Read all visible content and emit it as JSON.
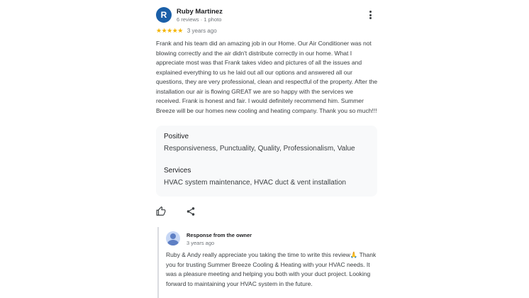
{
  "review": {
    "avatar_letter": "R",
    "name": "Ruby Martinez",
    "meta": "6 reviews · 1 photo",
    "stars": "★★★★★",
    "rating": 5,
    "date": "3 years ago",
    "text": "Frank and his team did an amazing job in our Home. Our Air Conditioner was not blowing correctly and the air didn't distribute correctly in our home. What I appreciate most was that Frank takes video and pictures of all the issues and explained everything to us he laid out all our options and answered all our questions, they are very professional, clean and respectful of the property. After the installation our air is flowing GREAT we are so happy with the services we received. Frank is honest and fair. I would definitely recommend him. Summer Breeze will be our homes new cooling and heating company. Thank you so much!!!",
    "attributes": [
      {
        "title": "Positive",
        "value": "Responsiveness, Punctuality, Quality, Professionalism, Value"
      },
      {
        "title": "Services",
        "value": "HVAC system maintenance, HVAC duct & vent installation"
      }
    ]
  },
  "owner_response": {
    "title": "Response from the owner",
    "date": "3 years ago",
    "text": "Ruby & Andy really appreciate you taking the time to write this review🙏 Thank you for trusting Summer Breeze Cooling & Heating with your HVAC needs. It was a pleasure meeting and helping you both with your duct project. Looking forward to maintaining your HVAC system in the future."
  },
  "colors": {
    "avatar": "#1a5fa8",
    "stars": "#f4b400",
    "attr_bg": "#f8f9fa"
  }
}
